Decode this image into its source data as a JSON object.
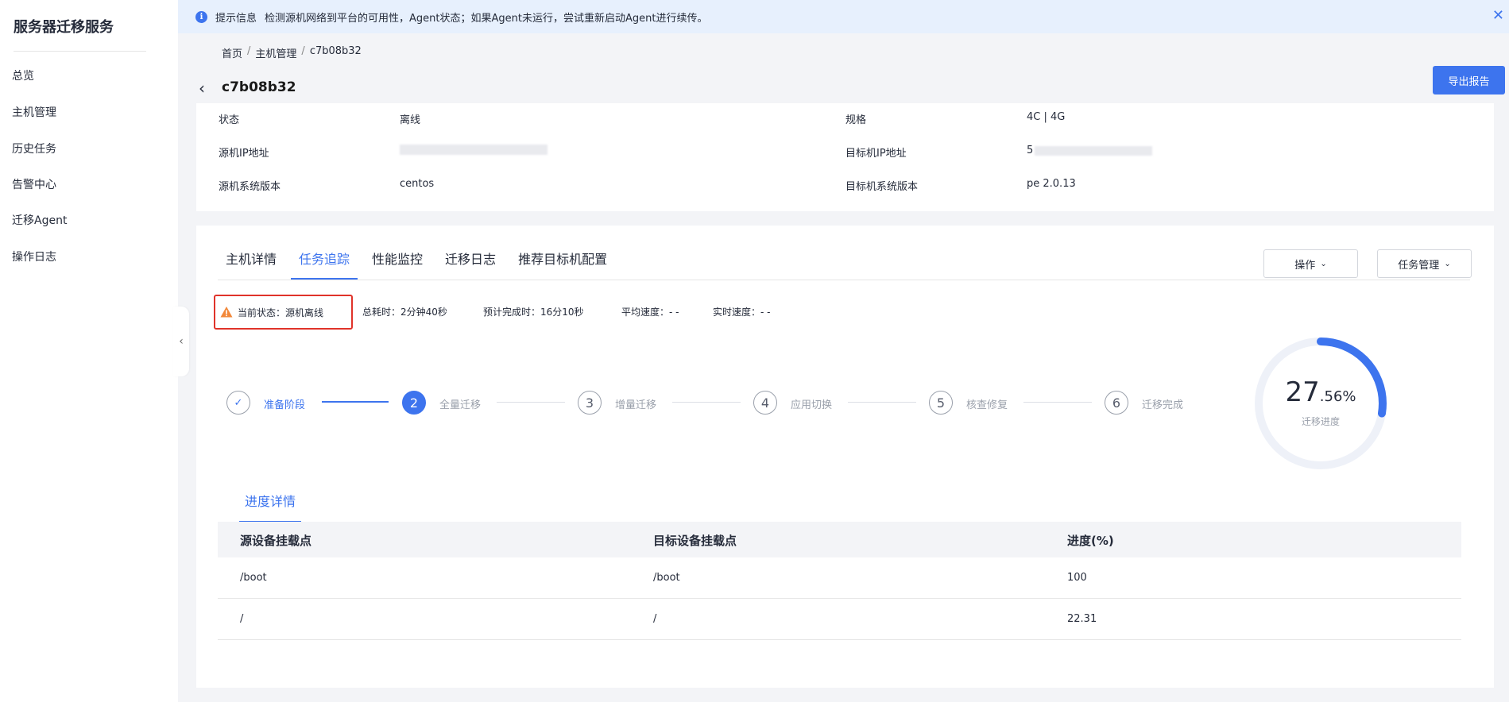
{
  "sidebar": {
    "app_title": "服务器迁移服务",
    "items": [
      {
        "label": "总览"
      },
      {
        "label": "主机管理"
      },
      {
        "label": "历史任务"
      },
      {
        "label": "告警中心"
      },
      {
        "label": "迁移Agent"
      },
      {
        "label": "操作日志"
      }
    ]
  },
  "banner": {
    "label": "提示信息",
    "message": "检测源机网络到平台的可用性，Agent状态；如果Agent未运行，尝试重新启动Agent进行续传。"
  },
  "breadcrumb": [
    "首页",
    "主机管理",
    "c7b08b32"
  ],
  "page_title": "c7b08b32",
  "export_label": "导出报告",
  "info": {
    "rows": [
      {
        "left_label": "状态",
        "left_value": "离线",
        "right_label": "规格",
        "right_value": "4C | 4G"
      },
      {
        "left_label": "源机IP地址",
        "left_value": "",
        "right_label": "目标机IP地址",
        "right_value": "5"
      },
      {
        "left_label": "源机系统版本",
        "left_value": "centos",
        "right_label": "目标机系统版本",
        "right_value": "pe 2.0.13"
      }
    ]
  },
  "tabs": [
    {
      "label": "主机详情",
      "active": false
    },
    {
      "label": "任务追踪",
      "active": true
    },
    {
      "label": "性能监控",
      "active": false
    },
    {
      "label": "迁移日志",
      "active": false
    },
    {
      "label": "推荐目标机配置",
      "active": false
    }
  ],
  "actions": {
    "operation_label": "操作",
    "task_mgmt_label": "任务管理"
  },
  "status": {
    "current_status": "当前状态：源机离线",
    "total_time": "总耗时：2分钟40秒",
    "eta": "预计完成时：16分10秒",
    "avg_speed": "平均速度：- -",
    "realtime_speed": "实时速度：- -"
  },
  "steps": [
    {
      "number": "✓",
      "label": "准备阶段",
      "state": "done"
    },
    {
      "number": "2",
      "label": "全量迁移",
      "state": "active"
    },
    {
      "number": "3",
      "label": "增量迁移",
      "state": "pending"
    },
    {
      "number": "4",
      "label": "应用切换",
      "state": "pending"
    },
    {
      "number": "5",
      "label": "核查修复",
      "state": "pending"
    },
    {
      "number": "6",
      "label": "迁移完成",
      "state": "pending"
    }
  ],
  "progress": {
    "integer": "27",
    "decimal": ".56%",
    "value": 27.56,
    "label": "迁移进度"
  },
  "detail_tab": "进度详情",
  "table": {
    "headers": [
      "源设备挂载点",
      "目标设备挂载点",
      "进度(%)"
    ],
    "rows": [
      [
        "/boot",
        "/boot",
        "100"
      ],
      [
        "/",
        "/",
        "22.31"
      ]
    ]
  },
  "colors": {
    "primary": "#3d74ee",
    "warning": "#f2883a",
    "status_border": "#e0332a",
    "banner_bg": "#e7f0fd"
  }
}
